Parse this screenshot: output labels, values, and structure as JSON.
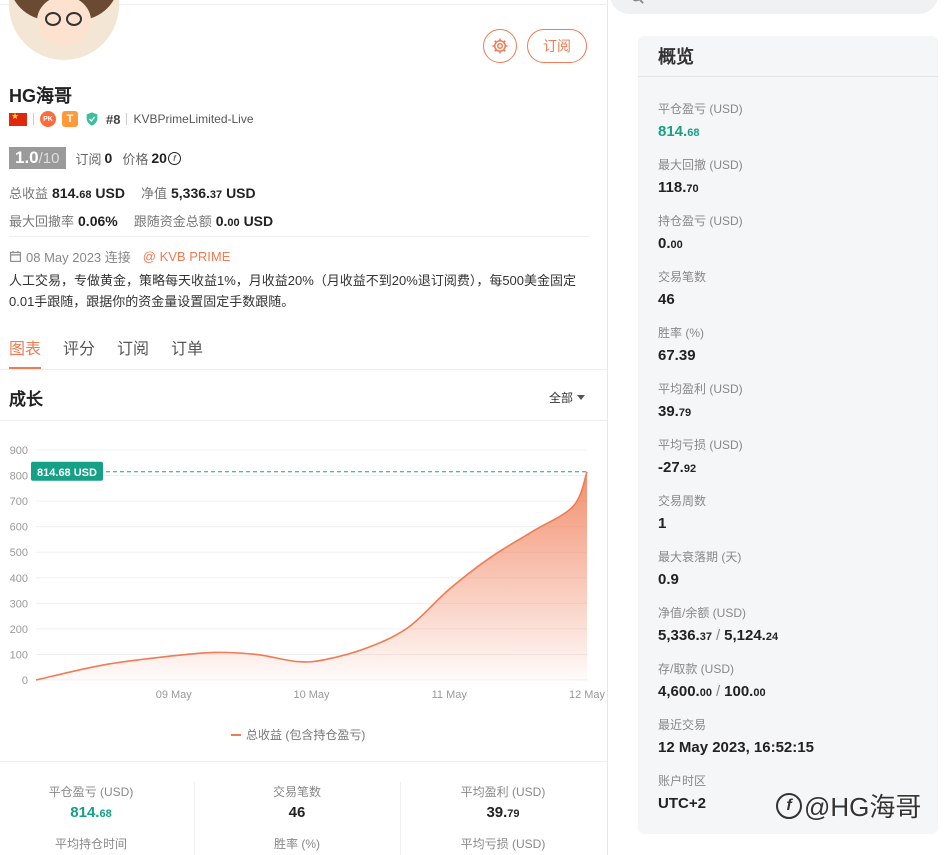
{
  "profile": {
    "name": "HG海哥",
    "rank": "#8",
    "server": "KVBPrimeLimited-Live",
    "pk_badge": "PK",
    "t_badge": "T",
    "score": "1.0",
    "score_total": "/10",
    "subscribe_label": "订阅",
    "subscribe_count": "0",
    "price_label": "价格",
    "price_value": "20",
    "price_coin": "f",
    "total_profit_label": "总收益",
    "total_profit_int": "814.",
    "total_profit_dec": "68",
    "total_profit_unit": "USD",
    "equity_label": "净值",
    "equity_int": "5,336.",
    "equity_dec": "37",
    "equity_unit": "USD",
    "max_drawdown_label": "最大回撤率",
    "max_drawdown_value": "0.06%",
    "follow_funds_label": "跟随资金总额",
    "follow_funds_int": "0.",
    "follow_funds_dec": "00",
    "follow_funds_unit": "USD",
    "connected_date": "08 May 2023 连接",
    "broker": "@ KVB PRIME",
    "description": "人工交易，专做黄金，策略每天收益1%，月收益20%（月收益不到20%退订阅费），每500美金固定0.01手跟随，跟据你的资金量设置固定手数跟随。"
  },
  "actions": {
    "subscribe_button": "订阅"
  },
  "tabs": [
    {
      "label": "图表",
      "active": true
    },
    {
      "label": "评分",
      "active": false
    },
    {
      "label": "订阅",
      "active": false
    },
    {
      "label": "订单",
      "active": false
    }
  ],
  "growth": {
    "title": "成长",
    "range": "全部"
  },
  "chart_data": {
    "type": "area",
    "x_ticks": [
      "09 May",
      "10 May",
      "11 May",
      "12 May"
    ],
    "y_ticks": [
      "0",
      "100",
      "200",
      "300",
      "400",
      "500",
      "600",
      "700",
      "800",
      "900"
    ],
    "ylim": [
      0,
      900
    ],
    "xlim": [
      0,
      4
    ],
    "series": [
      {
        "name": "总收益 (包含持仓盈亏)",
        "points": [
          [
            0,
            0
          ],
          [
            0.5,
            60
          ],
          [
            1,
            95
          ],
          [
            1.3,
            108
          ],
          [
            1.6,
            100
          ],
          [
            1.9,
            72
          ],
          [
            2.1,
            80
          ],
          [
            2.4,
            125
          ],
          [
            2.7,
            205
          ],
          [
            3,
            355
          ],
          [
            3.3,
            480
          ],
          [
            3.6,
            580
          ],
          [
            3.9,
            680
          ],
          [
            4.0,
            814.68
          ]
        ]
      }
    ],
    "current_value_label": "814.68 USD",
    "current_value": 814.68,
    "color": "#f07b54",
    "marker_color": "#16a085"
  },
  "bottom_stats": [
    {
      "label": "平仓盈亏 (USD)",
      "int": "814.",
      "dec": "68",
      "green": true
    },
    {
      "label": "交易笔数",
      "int": "46",
      "dec": "",
      "green": false
    },
    {
      "label": "平均盈利 (USD)",
      "int": "39.",
      "dec": "79",
      "green": false
    }
  ],
  "bottom_stats_row2": [
    "平均持仓时间",
    "胜率 (%)",
    "平均亏损 (USD)"
  ],
  "overview": {
    "title": "概览",
    "items": [
      {
        "label": "平仓盈亏 (USD)",
        "int": "814.",
        "dec": "68",
        "green": true
      },
      {
        "label": "最大回撤 (USD)",
        "int": "118.",
        "dec": "70"
      },
      {
        "label": "持仓盈亏 (USD)",
        "int": "0.",
        "dec": "00"
      },
      {
        "label": "交易笔数",
        "int": "46",
        "dec": ""
      },
      {
        "label": "胜率 (%)",
        "int": "67.39",
        "dec": ""
      },
      {
        "label": "平均盈利 (USD)",
        "int": "39.",
        "dec": "79"
      },
      {
        "label": "平均亏损 (USD)",
        "int": "-27.",
        "dec": "92"
      },
      {
        "label": "交易周数",
        "int": "1",
        "dec": ""
      },
      {
        "label": "最大衰落期 (天)",
        "int": "0.9",
        "dec": ""
      },
      {
        "label": "净值/余额 (USD)",
        "int": "5,336.",
        "dec": "37",
        "int2": "5,124.",
        "dec2": "24"
      },
      {
        "label": "存/取款 (USD)",
        "int": "4,600.",
        "dec": "00",
        "int2": "100.",
        "dec2": "00"
      },
      {
        "label": "最近交易",
        "int": "12 May 2023, 16:52:15",
        "dec": ""
      },
      {
        "label": "账户时区",
        "int": "UTC+2",
        "dec": ""
      }
    ]
  },
  "watermark": {
    "text": "@HG海哥",
    "logo": "f"
  },
  "icons": [
    "gear-icon",
    "calendar-icon",
    "shield-icon",
    "chevron-down-icon",
    "search-icon"
  ]
}
